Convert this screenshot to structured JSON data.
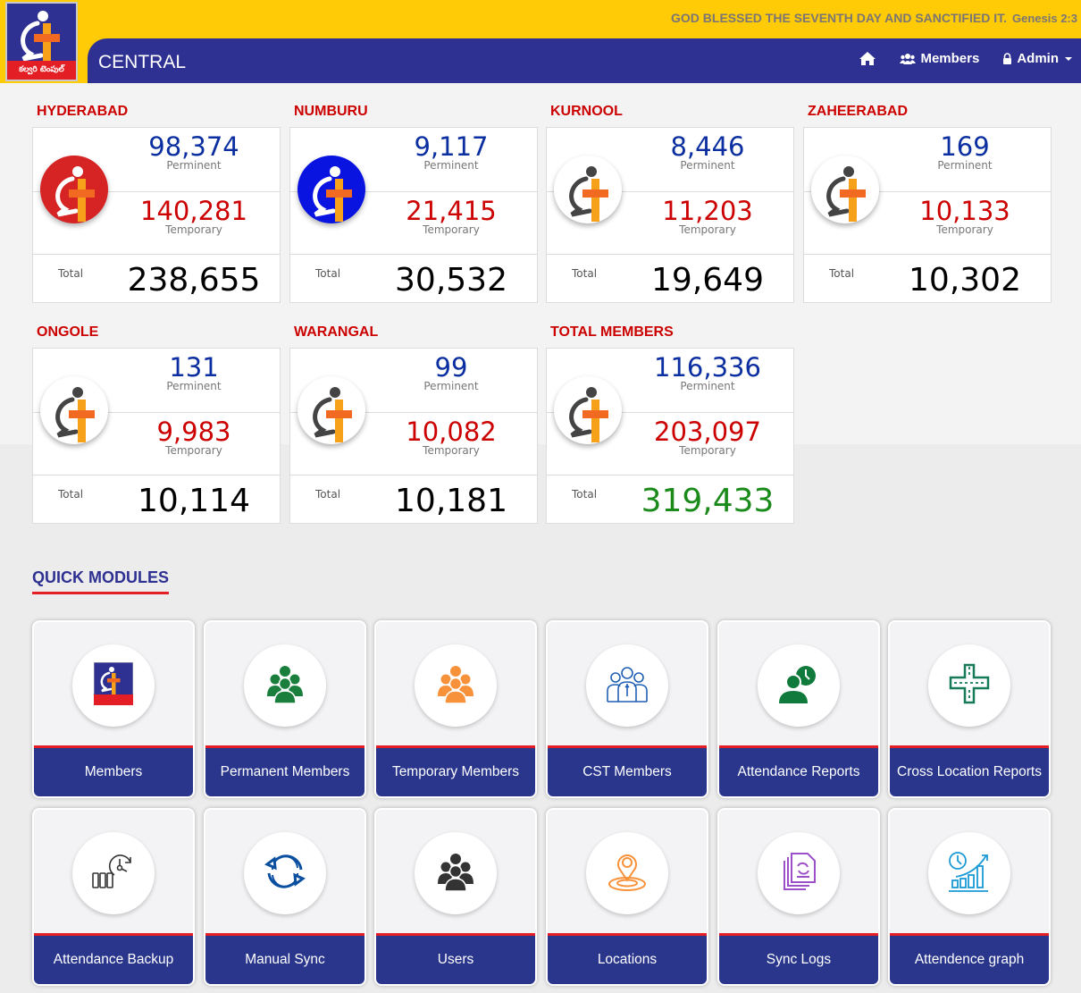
{
  "header": {
    "logo_text": "కల్వరి టెంపుల్",
    "verse": "GOD BLESSED THE SEVENTH DAY AND SANCTIFIED IT.",
    "verse_ref": "Genesis 2:3",
    "title": "CENTRAL",
    "nav": {
      "home_icon": "home-icon",
      "members_label": "Members",
      "members_icon": "users-icon",
      "admin_label": "Admin",
      "admin_icon": "lock-icon"
    }
  },
  "labels": {
    "permanent": "Perminent",
    "temporary": "Temporary",
    "total": "Total"
  },
  "locations": [
    {
      "name": "HYDERABAD",
      "permanent": "98,374",
      "temporary": "140,281",
      "total": "238,655",
      "logo_style": "red"
    },
    {
      "name": "NUMBURU",
      "permanent": "9,117",
      "temporary": "21,415",
      "total": "30,532",
      "logo_style": "blue"
    },
    {
      "name": "KURNOOL",
      "permanent": "8,446",
      "temporary": "11,203",
      "total": "19,649",
      "logo_style": "white"
    },
    {
      "name": "ZAHEERABAD",
      "permanent": "169",
      "temporary": "10,133",
      "total": "10,302",
      "logo_style": "white"
    },
    {
      "name": "ONGOLE",
      "permanent": "131",
      "temporary": "9,983",
      "total": "10,114",
      "logo_style": "white"
    },
    {
      "name": "WARANGAL",
      "permanent": "99",
      "temporary": "10,082",
      "total": "10,181",
      "logo_style": "white"
    },
    {
      "name": "TOTAL MEMBERS",
      "permanent": "116,336",
      "temporary": "203,097",
      "total": "319,433",
      "logo_style": "white"
    }
  ],
  "quick_modules": {
    "title": "QUICK MODULES",
    "items": [
      {
        "label": "Members",
        "icon": "church-logo-icon"
      },
      {
        "label": "Permanent Members",
        "icon": "group-icon",
        "color": "#1a7f3c"
      },
      {
        "label": "Temporary Members",
        "icon": "group-icon",
        "color": "#f7923a"
      },
      {
        "label": "CST Members",
        "icon": "team-outline-icon",
        "color": "#1f5fb4"
      },
      {
        "label": "Attendance Reports",
        "icon": "user-clock-icon",
        "color": "#0f7a3c"
      },
      {
        "label": "Cross Location Reports",
        "icon": "crossroads-icon",
        "color": "#167a5b"
      },
      {
        "label": "Attendance Backup",
        "icon": "backup-clock-icon",
        "color": "#333333"
      },
      {
        "label": "Manual Sync",
        "icon": "sync-icon",
        "color": "#0b4fa0"
      },
      {
        "label": "Users",
        "icon": "group-icon",
        "color": "#333333"
      },
      {
        "label": "Locations",
        "icon": "location-pin-icon",
        "color": "#f7923a"
      },
      {
        "label": "Sync Logs",
        "icon": "file-sync-icon",
        "color": "#9b4fc9"
      },
      {
        "label": "Attendence graph",
        "icon": "growth-chart-icon",
        "color": "#1a9ad6"
      }
    ]
  }
}
